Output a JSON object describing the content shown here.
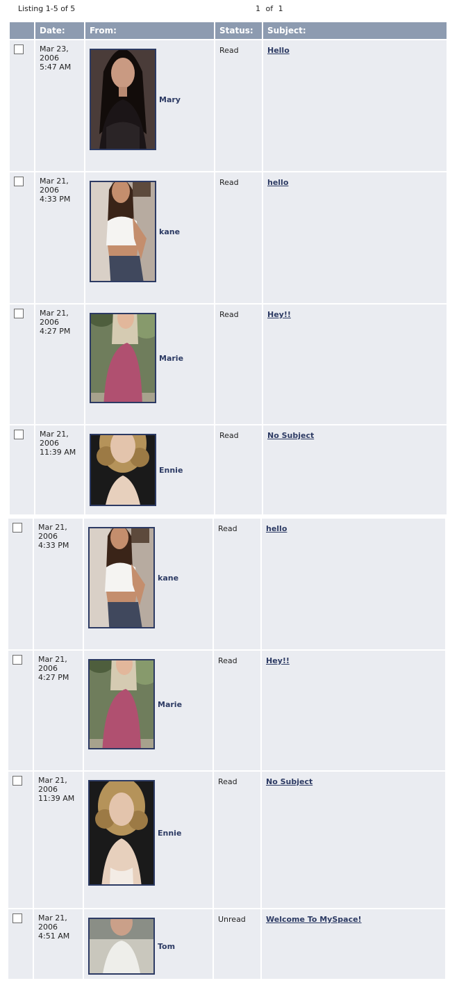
{
  "header": {
    "listing": "Listing 1-5 of 5",
    "page": "1",
    "of": "of",
    "total": "1"
  },
  "columns": {
    "date": "Date:",
    "from": "From:",
    "status": "Status:",
    "subject": "Subject:"
  },
  "messages_top": [
    {
      "date1": "Mar 23,",
      "date2": "2006",
      "date3": "5:47 AM",
      "from": "Mary",
      "status": "Read",
      "subject": "Hello",
      "avatar": "woman-dark-hair-photo"
    },
    {
      "date1": "Mar 21,",
      "date2": "2006",
      "date3": "4:33 PM",
      "from": "kane",
      "status": "Read",
      "subject": "hello",
      "avatar": "woman-white-top-photo"
    },
    {
      "date1": "Mar 21,",
      "date2": "2006",
      "date3": "4:27 PM",
      "from": "Marie",
      "status": "Read",
      "subject": "Hey!!",
      "avatar": "woman-pink-top-photo"
    },
    {
      "date1": "Mar 21,",
      "date2": "2006",
      "date3": "11:39 AM",
      "from": "Ennie",
      "status": "Read",
      "subject": "No Subject",
      "avatar": "woman-curly-hair-photo"
    }
  ],
  "messages_bottom": [
    {
      "date1": "Mar 21,",
      "date2": "2006",
      "date3": "4:33 PM",
      "from": "kane",
      "status": "Read",
      "subject": "hello",
      "avatar": "woman-white-top-photo"
    },
    {
      "date1": "Mar 21,",
      "date2": "2006",
      "date3": "4:27 PM",
      "from": "Marie",
      "status": "Read",
      "subject": "Hey!!",
      "avatar": "woman-pink-top-photo"
    },
    {
      "date1": "Mar 21,",
      "date2": "2006",
      "date3": "11:39 AM",
      "from": "Ennie",
      "status": "Read",
      "subject": "No Subject",
      "avatar": "woman-curly-hair-photo"
    },
    {
      "date1": "Mar 21,",
      "date2": "2006",
      "date3": "4:51 AM",
      "from": "Tom",
      "status": "Unread",
      "subject": "Welcome To MySpace!",
      "avatar": "man-smiling-photo"
    }
  ],
  "colors": {
    "header_bg": "#8d9bb0",
    "row_bg": "#eaecf1",
    "link": "#2c3a63"
  }
}
